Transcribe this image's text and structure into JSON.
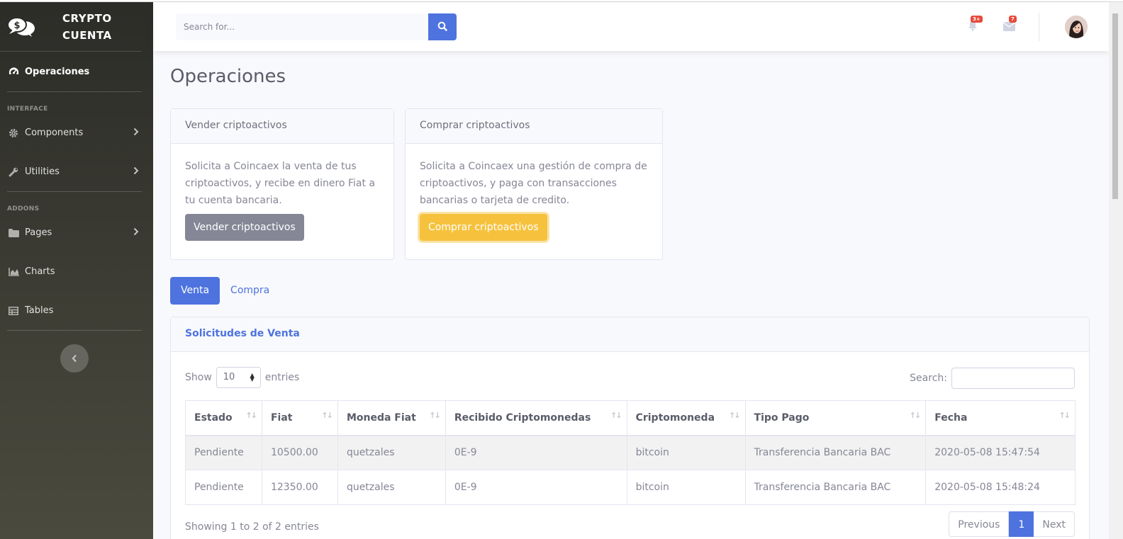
{
  "brand": {
    "line1": "CRYPTO",
    "line2": "CUENTA"
  },
  "sidebar": {
    "active_item": "Operaciones",
    "heading_interface": "INTERFACE",
    "heading_addons": "ADDONS",
    "items": [
      {
        "label": "Components",
        "icon": "gear-icon",
        "has_chevron": true
      },
      {
        "label": "Utilities",
        "icon": "wrench-icon",
        "has_chevron": true
      },
      {
        "label": "Pages",
        "icon": "folder-icon",
        "has_chevron": true
      },
      {
        "label": "Charts",
        "icon": "chart-area-icon",
        "has_chevron": false
      },
      {
        "label": "Tables",
        "icon": "table-icon",
        "has_chevron": false
      }
    ]
  },
  "topbar": {
    "search_placeholder": "Search for...",
    "alerts_badge": "3+",
    "messages_badge": "7"
  },
  "page": {
    "title": "Operaciones",
    "sell_card": {
      "header": "Vender criptoactivos",
      "body": "Solicita a Coincaex la venta de tus criptoactivos, y recibe en dinero Fiat a tu cuenta bancaria.",
      "button": "Vender criptoactivos"
    },
    "buy_card": {
      "header": "Comprar criptoactivos",
      "body": "Solicita a Coincaex una gestión de compra de criptoactivos, y paga con transacciones bancarias o tarjeta de credito.",
      "button": "Comprar criptoactivos"
    },
    "tabs": [
      "Venta",
      "Compra"
    ]
  },
  "table": {
    "title": "Solicitudes de Venta",
    "show_label": "Show",
    "entries_value": "10",
    "entries_label": "entries",
    "search_label": "Search:",
    "columns": [
      "Estado",
      "Fiat",
      "Moneda Fiat",
      "Recibido Criptomonedas",
      "Criptomoneda",
      "Tipo Pago",
      "Fecha"
    ],
    "rows": [
      [
        "Pendiente",
        "10500.00",
        "quetzales",
        "0E-9",
        "bitcoin",
        "Transferencia Bancaria BAC",
        "2020-05-08 15:47:54"
      ],
      [
        "Pendiente",
        "12350.00",
        "quetzales",
        "0E-9",
        "bitcoin",
        "Transferencia Bancaria BAC",
        "2020-05-08 15:48:24"
      ]
    ],
    "info": "Showing 1 to 2 of 2 entries",
    "pager": {
      "prev": "Previous",
      "current": "1",
      "next": "Next"
    }
  },
  "colors": {
    "primary": "#4e73df",
    "warning": "#f6c23e",
    "secondary": "#858796",
    "danger": "#e74a3b"
  }
}
